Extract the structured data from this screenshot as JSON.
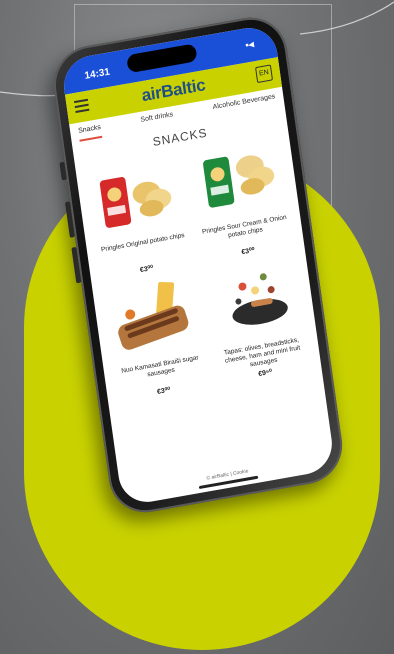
{
  "statusbar": {
    "time": "14:31",
    "signal": "▪◂"
  },
  "app": {
    "logo": "airBaltic",
    "lang_label": "EN"
  },
  "tabs": [
    {
      "label": "Snacks",
      "active": true
    },
    {
      "label": "Soft drinks",
      "active": false
    },
    {
      "label": "Alcoholic Beverages",
      "active": false
    }
  ],
  "heading": "SNACKS",
  "products": [
    {
      "name": "Pringles Original potato chips",
      "price": "€3⁰⁰"
    },
    {
      "name": "Pringles Sour Cream & Onion potato chips",
      "price": "€3⁰⁰"
    },
    {
      "name": "Nuo Kamasati Biraiši sugar sausages",
      "price": "€3⁰⁰"
    },
    {
      "name": "Tapas: olives, breadsticks, cheese, ham and mini fruit sausages",
      "price": "€9⁵⁰"
    }
  ],
  "footer": "© airBaltic  |  Cookie",
  "colors": {
    "brand_lime": "#c9d200",
    "brand_blue": "#1a4fd8",
    "accent_red": "#e04e3c"
  }
}
